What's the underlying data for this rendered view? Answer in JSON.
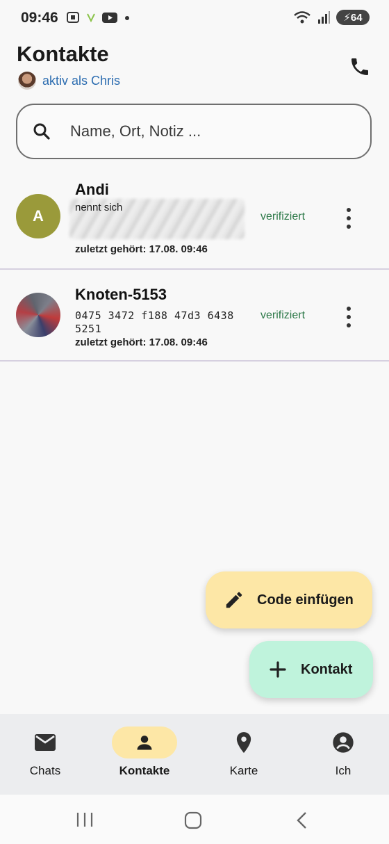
{
  "status_bar": {
    "time": "09:46",
    "battery": "64"
  },
  "header": {
    "title": "Kontakte",
    "active_user": "aktiv als Chris"
  },
  "search": {
    "placeholder": "Name, Ort, Notiz ..."
  },
  "contacts": [
    {
      "avatar_letter": "A",
      "avatar_color": "#9a9a3a",
      "name": "Andi",
      "subtitle": "nennt sich",
      "status": "verifiziert",
      "last_heard": "zuletzt gehört: 17.08. 09:46"
    },
    {
      "name": "Knoten-5153",
      "key_line1": "0475 3472 f188 47d3 6438",
      "key_line2": "5251",
      "status": "verifiziert",
      "last_heard": "zuletzt gehört: 17.08. 09:46"
    }
  ],
  "fabs": {
    "paste_code": "Code einfügen",
    "add_contact": "Kontakt"
  },
  "bottom_nav": {
    "items": [
      {
        "label": "Chats",
        "icon": "mail-icon"
      },
      {
        "label": "Kontakte",
        "icon": "person-icon",
        "active": true
      },
      {
        "label": "Karte",
        "icon": "location-pin-icon"
      },
      {
        "label": "Ich",
        "icon": "account-circle-icon"
      }
    ]
  },
  "colors": {
    "accent_yellow": "#fde7a6",
    "accent_mint": "#bff3dc",
    "verified_green": "#2f7a4a",
    "link_blue": "#2b6cb0"
  }
}
